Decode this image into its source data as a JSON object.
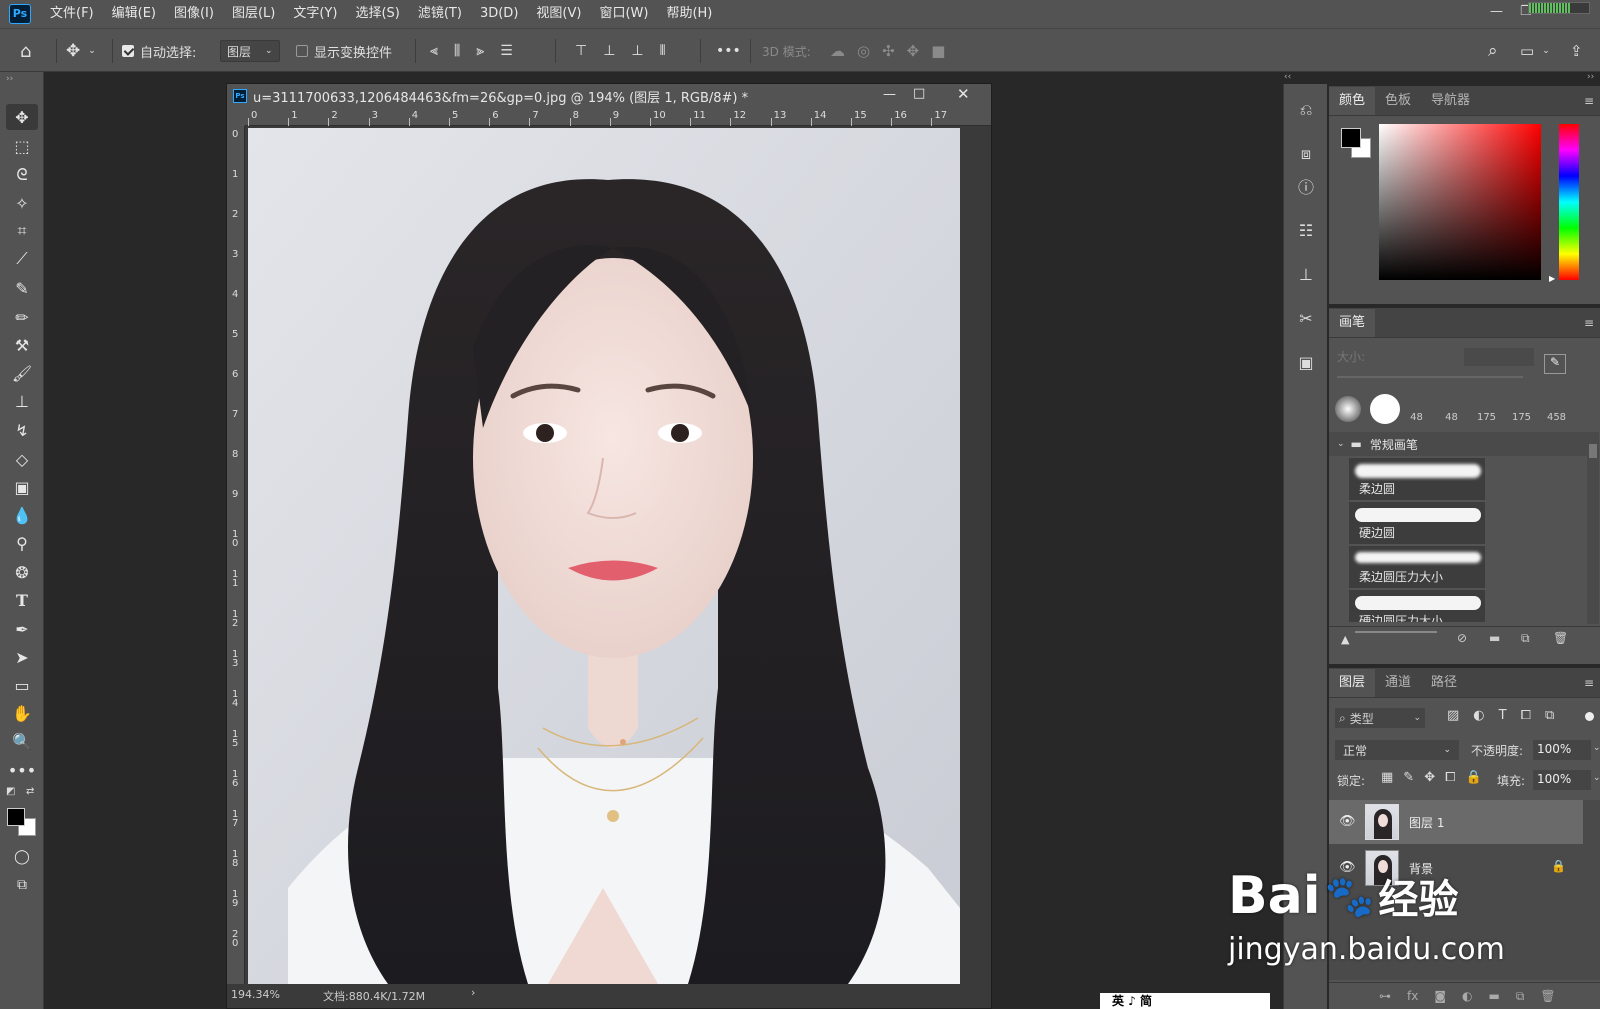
{
  "menu": {
    "items": [
      "文件(F)",
      "编辑(E)",
      "图像(I)",
      "图层(L)",
      "文字(Y)",
      "选择(S)",
      "滤镜(T)",
      "3D(D)",
      "视图(V)",
      "窗口(W)",
      "帮助(H)"
    ],
    "app_icon": "Ps"
  },
  "options": {
    "auto_select_label": "自动选择:",
    "auto_select_value": "图层",
    "show_transform_label": "显示变换控件",
    "mode_3d_label": "3D 模式:",
    "more_label": "•••"
  },
  "document": {
    "title": "u=3111700633,1206484463&fm=26&gp=0.jpg @ 194% (图层 1, RGB/8#) *",
    "ruler_h": [
      "0",
      "1",
      "2",
      "3",
      "4",
      "5",
      "6",
      "7",
      "8",
      "9",
      "10",
      "11",
      "12",
      "13",
      "14",
      "15",
      "16",
      "17"
    ],
    "ruler_v": [
      "0",
      "1",
      "2",
      "3",
      "4",
      "5",
      "6",
      "7",
      "8",
      "9",
      "1\n0",
      "1\n1",
      "1\n2",
      "1\n3",
      "1\n4",
      "1\n5",
      "1\n6",
      "1\n7",
      "1\n8",
      "1\n9",
      "2\n0"
    ],
    "zoom": "194.34%",
    "doc_size": "文档:880.4K/1.72M"
  },
  "color_panel": {
    "tabs": [
      "颜色",
      "色板",
      "导航器"
    ],
    "active_tab": "颜色",
    "foreground": "#000000",
    "background": "#ffffff",
    "hue": "#ff0000"
  },
  "brush_panel": {
    "title": "画笔",
    "size_label": "大小:",
    "presets": [
      "48",
      "48",
      "175",
      "175",
      "458"
    ],
    "group_name": "常规画笔",
    "brushes": [
      "柔边圆",
      "硬边圆",
      "柔边圆压力大小",
      "硬边圆压力大小"
    ]
  },
  "layers_panel": {
    "tabs": [
      "图层",
      "通道",
      "路径"
    ],
    "active_tab": "图层",
    "filter_label": "类型",
    "blend_mode": "正常",
    "opacity_label": "不透明度:",
    "opacity_value": "100%",
    "lock_label": "锁定:",
    "fill_label": "填充:",
    "fill_value": "100%",
    "layers": [
      {
        "name": "图层 1",
        "selected": true,
        "locked": false
      },
      {
        "name": "背景",
        "selected": false,
        "locked": true
      }
    ]
  },
  "watermark": {
    "brand": "Bai",
    "brand_cn": "经验",
    "url": "jingyan.baidu.com"
  },
  "ime": {
    "text": "英 ♪ 简"
  }
}
